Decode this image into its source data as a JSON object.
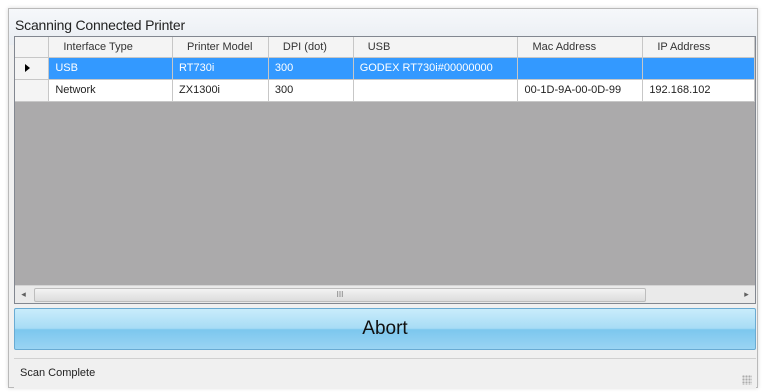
{
  "window": {
    "title": "Scanning Connected Printer"
  },
  "grid": {
    "columns": [
      "Interface Type",
      "Printer Model",
      "DPI (dot)",
      "USB",
      "Mac Address",
      "IP Address"
    ],
    "rows": [
      {
        "selected": true,
        "cells": [
          "USB",
          "RT730i",
          "300",
          "GODEX RT730i#00000000",
          "",
          ""
        ]
      },
      {
        "selected": false,
        "cells": [
          "Network",
          "ZX1300i",
          "300",
          "",
          "00-1D-9A-00-0D-99",
          "192.168.102"
        ]
      }
    ],
    "selected_row_color": "#3399ff",
    "hscroll": {
      "left_glyph": "◂",
      "thumb_glyph": "III",
      "right_glyph": "▸"
    }
  },
  "abort_button": {
    "label": "Abort"
  },
  "status": {
    "text": "Scan Complete"
  }
}
